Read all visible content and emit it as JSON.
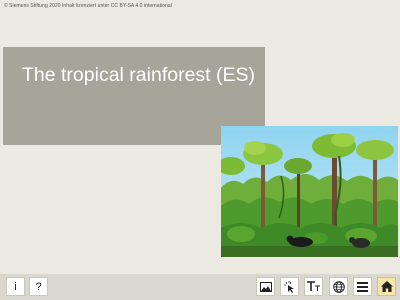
{
  "copyright": "© Siemens Stiftung 2020 Inhalt lizenziert unter CC BY-SA 4.0 international",
  "title": "The tropical rainforest (ES)",
  "toolbar": {
    "left": [
      {
        "label": "i",
        "icon": "info-icon"
      },
      {
        "label": "?",
        "icon": "help-icon"
      }
    ],
    "right": [
      {
        "icon": "image-icon"
      },
      {
        "icon": "pointer-click-icon"
      },
      {
        "icon": "text-size-icon"
      },
      {
        "icon": "globe-icon"
      },
      {
        "icon": "menu-icon"
      },
      {
        "icon": "home-icon",
        "active": true
      }
    ]
  },
  "colors": {
    "background": "#ebe9e1",
    "title_box": "#a7a499",
    "toolbar": "#d9d7ce",
    "home_active": "#f6e7a8"
  }
}
